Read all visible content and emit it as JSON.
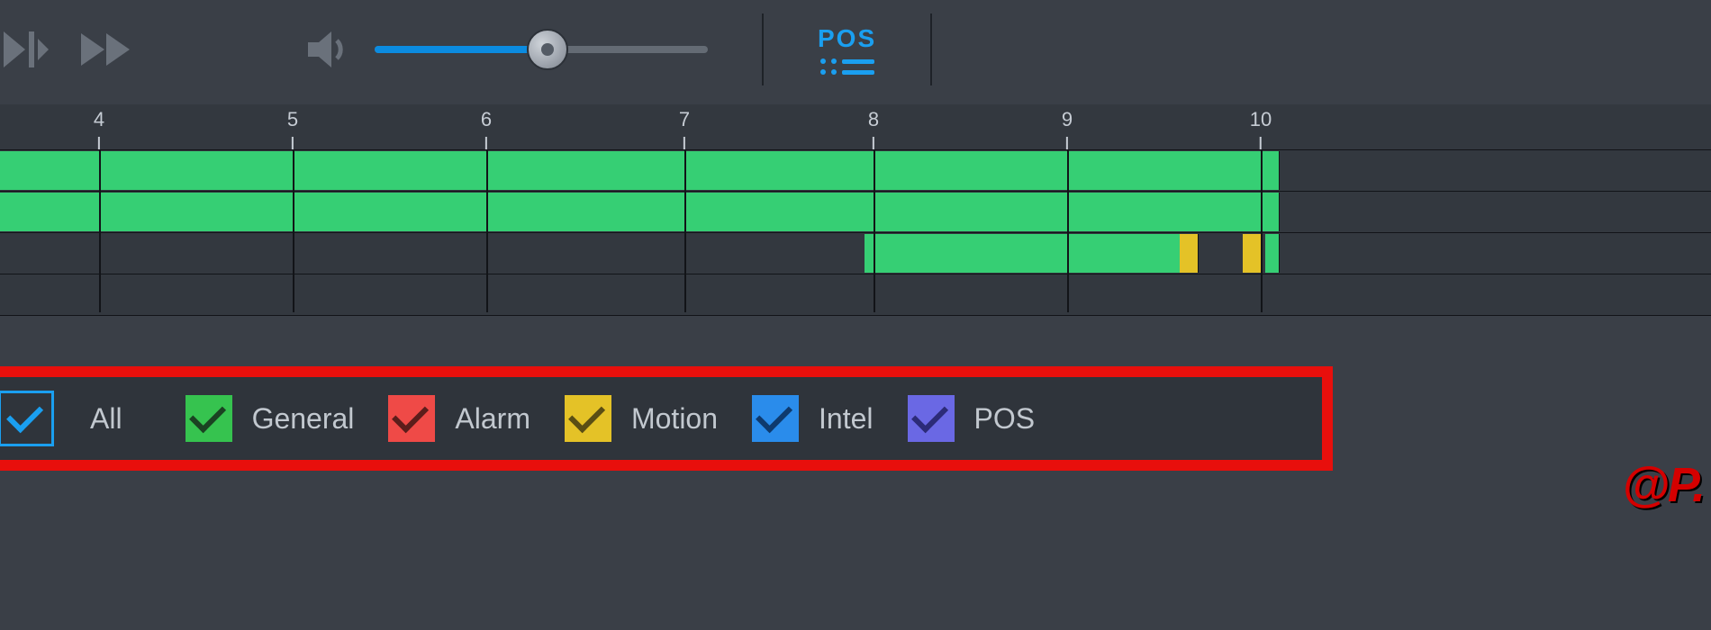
{
  "toolbar": {
    "pos_label": "POS",
    "volume_percent": 52
  },
  "ruler": {
    "labels": [
      "4",
      "5",
      "6",
      "7",
      "8",
      "9",
      "10"
    ]
  },
  "tracks": [
    {
      "clips": [
        {
          "start": 0,
          "end": 1420,
          "type": "green"
        }
      ]
    },
    {
      "clips": [
        {
          "start": 0,
          "end": 1420,
          "type": "green"
        }
      ]
    },
    {
      "clips": [
        {
          "start": 960,
          "end": 1100,
          "type": "green"
        },
        {
          "start": 1100,
          "end": 1310,
          "type": "green"
        },
        {
          "start": 1310,
          "end": 1320,
          "type": "yellow"
        },
        {
          "start": 1320,
          "end": 1330,
          "type": "yellow"
        },
        {
          "start": 1380,
          "end": 1400,
          "type": "yellow"
        },
        {
          "start": 1405,
          "end": 1420,
          "type": "green"
        }
      ]
    },
    {
      "clips": []
    }
  ],
  "vlines": [
    110,
    325,
    540,
    760,
    970,
    1185,
    1400
  ],
  "filters": {
    "all_label": "All",
    "items": [
      {
        "label": "General",
        "color": "green",
        "check": "#1b4222"
      },
      {
        "label": "Alarm",
        "color": "red",
        "check": "#5c1d1b"
      },
      {
        "label": "Motion",
        "color": "yellow",
        "check": "#5a4e14"
      },
      {
        "label": "Intel",
        "color": "blue",
        "check": "#0e3a6e"
      },
      {
        "label": "POS",
        "color": "purple",
        "check": "#2c2b78"
      }
    ]
  },
  "logo": "@P."
}
